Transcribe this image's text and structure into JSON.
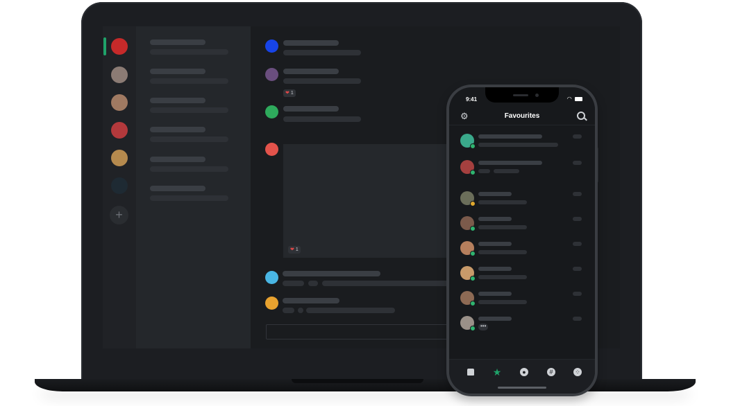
{
  "colors": {
    "accent": "#1fa36a",
    "online": "#2fb36f",
    "idle": "#e0a82e",
    "avatar_blue": "#1744e8",
    "avatar_purple": "#6a4e7e",
    "avatar_green": "#2eaa5c",
    "avatar_red": "#e3534b",
    "avatar_cyan": "#49b6e4",
    "avatar_yellow": "#e8a22f"
  },
  "laptop": {
    "servers": [
      {
        "name": "server-red",
        "color": "#c62a2a"
      },
      {
        "name": "server-photo-1",
        "color": "#8b7b74"
      },
      {
        "name": "server-photo-2",
        "color": "#a07a62"
      },
      {
        "name": "server-red-car",
        "color": "#b3393c"
      },
      {
        "name": "server-gold",
        "color": "#b58a4e"
      },
      {
        "name": "server-space",
        "color": "#1e2a33"
      }
    ],
    "add_server_label": "+",
    "messages": [
      {
        "reaction_count": "1"
      },
      {
        "reaction_count": "1"
      }
    ]
  },
  "phone": {
    "status_time": "9:41",
    "status_icons": "▴ ◖",
    "title": "Favourites",
    "presence": [
      "online",
      "online",
      "idle",
      "online",
      "online",
      "online",
      "online",
      "online"
    ],
    "typing_indicator": "•••",
    "tabs": [
      "home",
      "favourites",
      "profile",
      "channels",
      "servers"
    ]
  }
}
